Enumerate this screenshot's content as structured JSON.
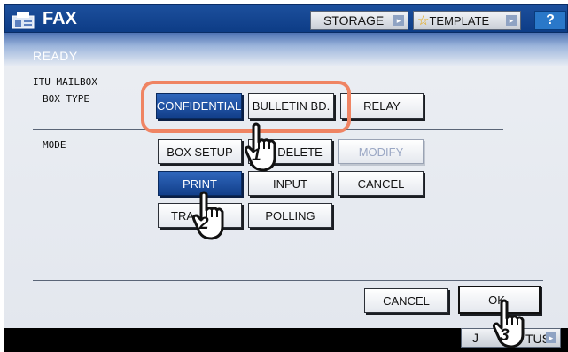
{
  "header": {
    "title": "FAX",
    "storage_label": "STORAGE",
    "template_label": "TEMPLATE",
    "help_label": "?"
  },
  "status": {
    "ready": "READY"
  },
  "section": {
    "heading": "ITU MAILBOX",
    "box_type_label": "BOX TYPE",
    "mode_label": "MODE"
  },
  "box_type": {
    "confidential": "CONFIDENTIAL",
    "bulletin": "BULLETIN BD.",
    "relay": "RELAY"
  },
  "mode": {
    "box_setup": "BOX SETUP",
    "delete": "DELETE",
    "modify": "MODIFY",
    "print": "PRINT",
    "input": "INPUT",
    "cancel": "CANCEL",
    "transmit_partial": "TRA",
    "polling": "POLLING"
  },
  "footer": {
    "cancel": "CANCEL",
    "ok": "OK",
    "job_status_partial": "J",
    "job_status_tail": "TUS"
  },
  "callouts": [
    "1",
    "2",
    "3"
  ],
  "colors": {
    "title_bar": "#0d3c86",
    "selected_button": "#123f8a",
    "highlight": "#ef8463"
  }
}
